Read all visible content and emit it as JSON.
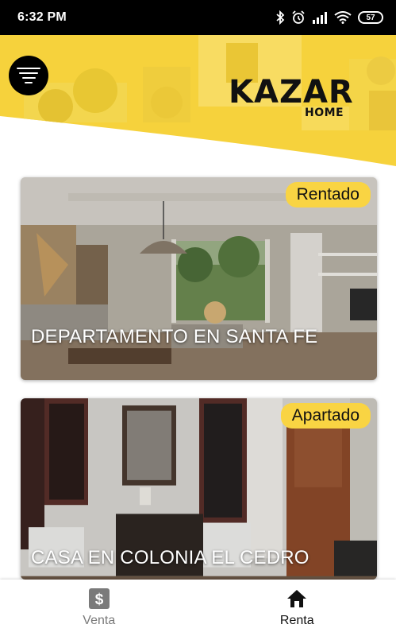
{
  "status_bar": {
    "time": "6:32 PM",
    "battery": "57"
  },
  "header": {
    "brand_name": "KAZAR",
    "brand_sub": "HOME",
    "accent_color": "#f9d443"
  },
  "listings": [
    {
      "title": "DEPARTAMENTO EN SANTA FE",
      "status": "Rentado"
    },
    {
      "title": "CASA EN COLONIA EL CEDRO",
      "status": "Apartado"
    }
  ],
  "bottom_nav": {
    "items": [
      {
        "label": "Venta",
        "icon": "dollar-icon",
        "active": false
      },
      {
        "label": "Renta",
        "icon": "home-icon",
        "active": true
      }
    ]
  }
}
